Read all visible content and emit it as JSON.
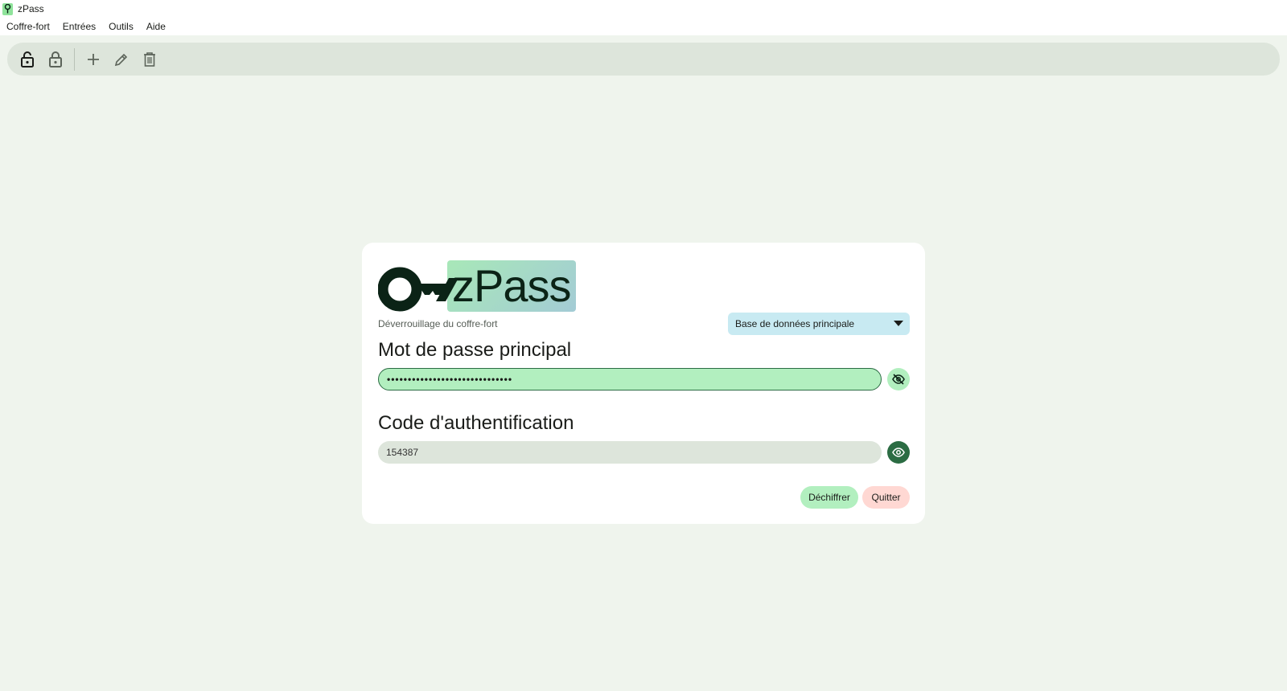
{
  "window": {
    "title": "zPass"
  },
  "menu": {
    "items": [
      "Coffre-fort",
      "Entrées",
      "Outils",
      "Aide"
    ]
  },
  "toolbar": {
    "buttons": [
      "unlock-icon",
      "lock-icon",
      "plus-icon",
      "pencil-icon",
      "trash-icon"
    ]
  },
  "logo": {
    "text": "zPass"
  },
  "unlock": {
    "subtitle": "Déverrouillage du coffre-fort",
    "database_selected": "Base de données principale",
    "password_label": "Mot de passe principal",
    "password_value": "••••••••••••••••••••••••••••••",
    "code_label": "Code d'authentification",
    "code_value": "154387",
    "decrypt_label": "Déchiffrer",
    "quit_label": "Quitter"
  },
  "colors": {
    "background": "#eff4ed",
    "accent_green": "#b2efbf",
    "dark_green": "#2b6c43",
    "select_blue": "#c8eaf2",
    "quit_pink": "#ffd8d3"
  }
}
